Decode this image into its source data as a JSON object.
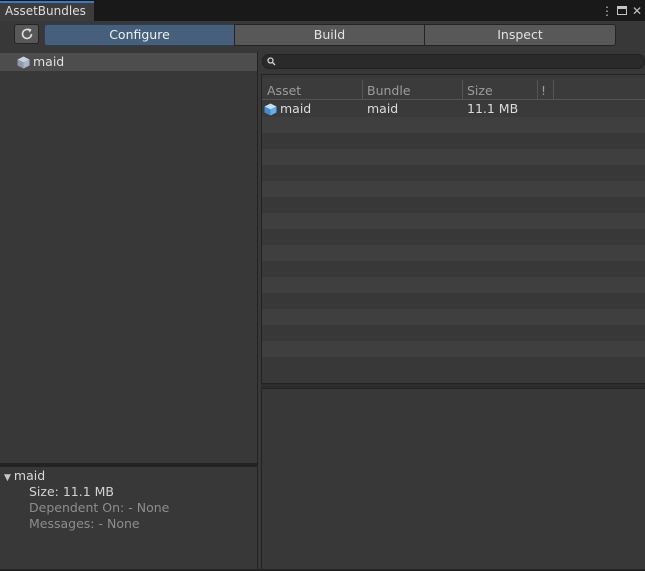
{
  "window": {
    "tab_title": "AssetBundles",
    "controls": [
      "kebab-menu-icon",
      "maximize-icon",
      "close-icon"
    ]
  },
  "toolbar": {
    "refresh_icon": "refresh-icon",
    "tabs": [
      {
        "label": "Configure",
        "active": true
      },
      {
        "label": "Build",
        "active": false
      },
      {
        "label": "Inspect",
        "active": false
      }
    ]
  },
  "bundle_tree": {
    "items": [
      {
        "label": "maid",
        "icon": "cube-icon",
        "selected": true
      }
    ]
  },
  "details": {
    "name": "maid",
    "size_line": "Size: 11.1 MB",
    "dependent_line": "Dependent On: - None",
    "messages_line": "Messages: - None"
  },
  "search": {
    "icon": "search-icon",
    "value": ""
  },
  "asset_table": {
    "columns": [
      "Asset",
      "Bundle",
      "Size",
      "!"
    ],
    "rows": [
      {
        "asset": "maid",
        "bundle": "maid",
        "size": "11.1 MB",
        "icon": "cube-icon"
      }
    ]
  },
  "colors": {
    "accent": "#3a79bb",
    "active_tab": "#46607c",
    "panel_bg": "#383838"
  }
}
